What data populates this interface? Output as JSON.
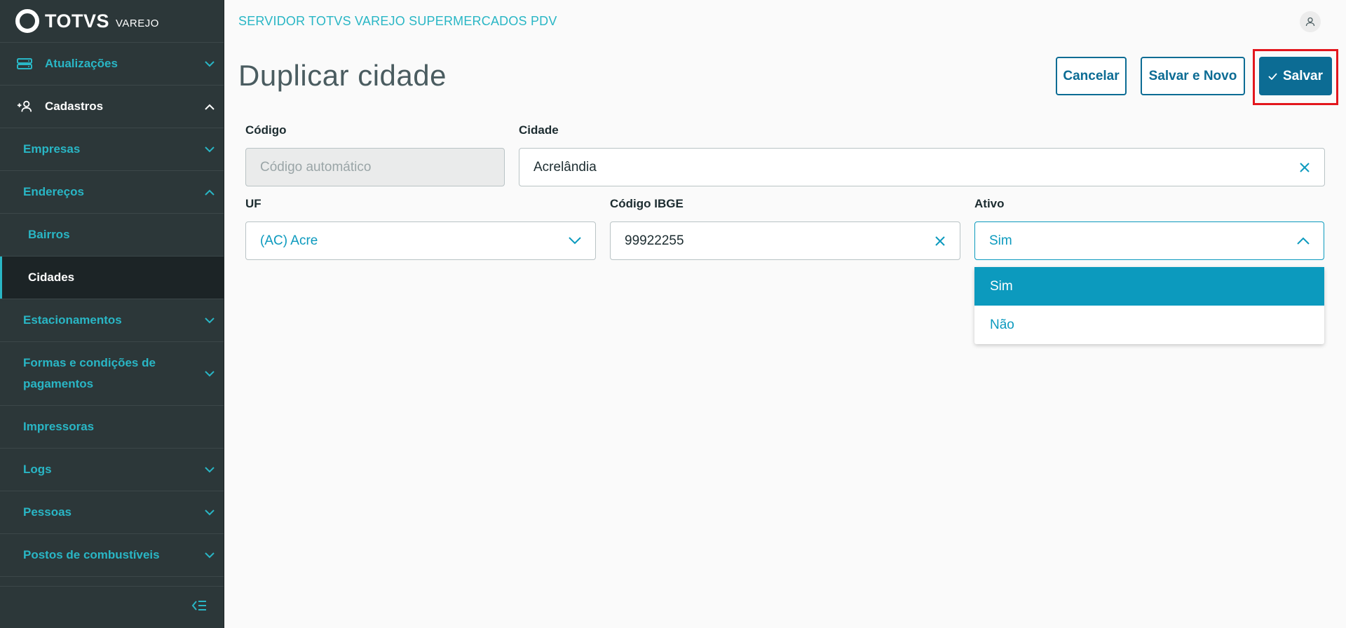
{
  "brand": {
    "name": "TOTVS",
    "sub": "VAREJO"
  },
  "header": {
    "server": "SERVIDOR TOTVS VAREJO SUPERMERCADOS PDV"
  },
  "sidebar": {
    "items": [
      {
        "label": "Atualizações"
      },
      {
        "label": "Cadastros"
      },
      {
        "label": "Empresas"
      },
      {
        "label": "Endereços"
      },
      {
        "label": "Bairros"
      },
      {
        "label": "Cidades"
      },
      {
        "label": "Estacionamentos"
      },
      {
        "label": "Formas e condições de",
        "label2": "pagamentos"
      },
      {
        "label": "Impressoras"
      },
      {
        "label": "Logs"
      },
      {
        "label": "Pessoas"
      },
      {
        "label": "Postos de combustíveis"
      }
    ]
  },
  "page": {
    "title": "Duplicar cidade"
  },
  "actions": {
    "cancel": "Cancelar",
    "save_new": "Salvar e Novo",
    "save": "Salvar"
  },
  "form": {
    "codigo": {
      "label": "Código",
      "placeholder": "Código automático"
    },
    "cidade": {
      "label": "Cidade",
      "value": "Acrelândia"
    },
    "uf": {
      "label": "UF",
      "value": "(AC) Acre"
    },
    "ibge": {
      "label": "Código IBGE",
      "value": "99922255"
    },
    "ativo": {
      "label": "Ativo",
      "value": "Sim",
      "options": [
        "Sim",
        "Não"
      ]
    }
  },
  "colors": {
    "accent": "#29b6c5",
    "primary": "#0c6c94",
    "highlight": "#e3161d",
    "sidebar": "#2c3739"
  }
}
